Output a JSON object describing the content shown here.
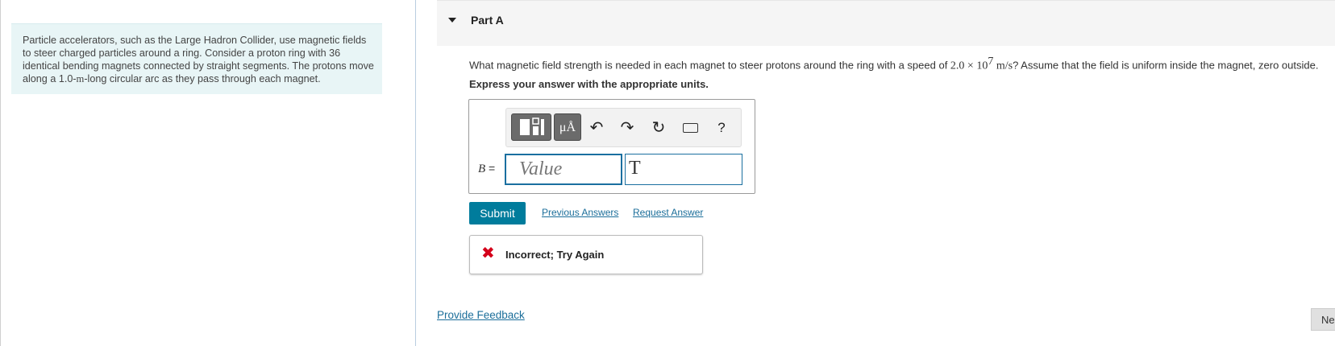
{
  "intro": {
    "text_1": "Particle accelerators, such as the Large Hadron Collider, use magnetic fields to steer charged particles around a ring. Consider a proton ring with 36 identical bending magnets connected by straight segments. The protons move along a 1.0-",
    "unit_m": "m",
    "text_2": "-long circular arc as they pass through each magnet."
  },
  "part": {
    "title": "Part A"
  },
  "question": {
    "text_1": "What magnetic field strength is needed in each magnet to steer protons around the ring with a speed of ",
    "value": "2.0 × 10",
    "exponent": "7",
    "units": " m/s",
    "text_2": "? Assume that the field is uniform inside the magnet, zero outside."
  },
  "instruction": "Express your answer with the appropriate units.",
  "toolbar": {
    "units_label": "μÅ",
    "undo_icon": "↶",
    "redo_icon": "↷",
    "reset_icon": "↻",
    "help_label": "?"
  },
  "answer": {
    "variable": "B",
    "equals": " =",
    "value_placeholder": "Value",
    "unit_value": "T"
  },
  "actions": {
    "submit_label": "Submit",
    "previous_answers_label": "Previous Answers",
    "request_answer_label": "Request Answer"
  },
  "feedback": {
    "icon": "✖",
    "text": "Incorrect; Try Again"
  },
  "footer": {
    "provide_feedback_label": "Provide Feedback",
    "next_label": "Ne"
  },
  "colors": {
    "accent": "#007c9c",
    "error": "#d4001a",
    "intro_bg": "#e8f5f6"
  }
}
